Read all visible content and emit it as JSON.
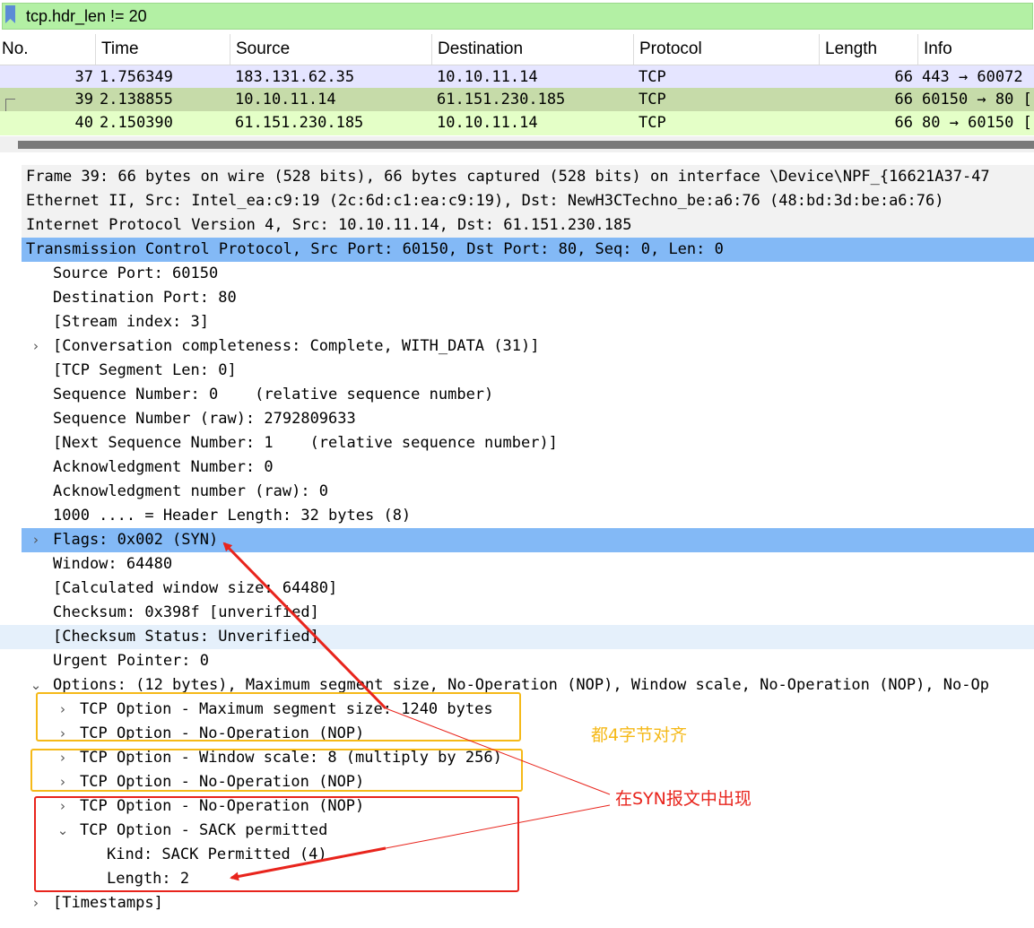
{
  "filter": {
    "value": "tcp.hdr_len != 20"
  },
  "columns": [
    "No.",
    "Time",
    "Source",
    "Destination",
    "Protocol",
    "Length",
    "Info"
  ],
  "packets": [
    {
      "no": "37",
      "time": "1.756349",
      "source": "183.131.62.35",
      "destination": "10.10.11.14",
      "protocol": "TCP",
      "length": "66",
      "info": "443 → 60072",
      "color": "#e5e5ff"
    },
    {
      "no": "39",
      "time": "2.138855",
      "source": "10.10.11.14",
      "destination": "61.151.230.185",
      "protocol": "TCP",
      "length": "66",
      "info": "60150 → 80 [",
      "color": "#c6dba9"
    },
    {
      "no": "40",
      "time": "2.150390",
      "source": "61.151.230.185",
      "destination": "10.10.11.14",
      "protocol": "TCP",
      "length": "66",
      "info": "80 → 60150 [",
      "color": "#e4ffc7"
    }
  ],
  "details": [
    {
      "indent": 0,
      "caret": ">",
      "text": "Frame 39: 66 bytes on wire (528 bits), 66 bytes captured (528 bits) on interface \\Device\\NPF_{16621A37-47",
      "style": "gray"
    },
    {
      "indent": 0,
      "caret": ">",
      "text": "Ethernet II, Src: Intel_ea:c9:19 (2c:6d:c1:ea:c9:19), Dst: NewH3CTechno_be:a6:76 (48:bd:3d:be:a6:76)",
      "style": "gray"
    },
    {
      "indent": 0,
      "caret": ">",
      "text": "Internet Protocol Version 4, Src: 10.10.11.14, Dst: 61.151.230.185",
      "style": "gray"
    },
    {
      "indent": 0,
      "caret": "v",
      "text": "Transmission Control Protocol, Src Port: 60150, Dst Port: 80, Seq: 0, Len: 0",
      "style": "sel"
    },
    {
      "indent": 1,
      "caret": "",
      "text": "Source Port: 60150",
      "style": ""
    },
    {
      "indent": 1,
      "caret": "",
      "text": "Destination Port: 80",
      "style": ""
    },
    {
      "indent": 1,
      "caret": "",
      "text": "[Stream index: 3]",
      "style": ""
    },
    {
      "indent": 1,
      "caret": ">",
      "text": "[Conversation completeness: Complete, WITH_DATA (31)]",
      "style": ""
    },
    {
      "indent": 1,
      "caret": "",
      "text": "[TCP Segment Len: 0]",
      "style": ""
    },
    {
      "indent": 1,
      "caret": "",
      "text": "Sequence Number: 0    (relative sequence number)",
      "style": ""
    },
    {
      "indent": 1,
      "caret": "",
      "text": "Sequence Number (raw): 2792809633",
      "style": ""
    },
    {
      "indent": 1,
      "caret": "",
      "text": "[Next Sequence Number: 1    (relative sequence number)]",
      "style": ""
    },
    {
      "indent": 1,
      "caret": "",
      "text": "Acknowledgment Number: 0",
      "style": ""
    },
    {
      "indent": 1,
      "caret": "",
      "text": "Acknowledgment number (raw): 0",
      "style": ""
    },
    {
      "indent": 1,
      "caret": "",
      "text": "1000 .... = Header Length: 32 bytes (8)",
      "style": ""
    },
    {
      "indent": 1,
      "caret": ">",
      "text": "Flags: 0x002 (SYN)",
      "style": "sel"
    },
    {
      "indent": 1,
      "caret": "",
      "text": "Window: 64480",
      "style": ""
    },
    {
      "indent": 1,
      "caret": "",
      "text": "[Calculated window size: 64480]",
      "style": ""
    },
    {
      "indent": 1,
      "caret": "",
      "text": "Checksum: 0x398f [unverified]",
      "style": ""
    },
    {
      "indent": 1,
      "caret": "",
      "text": "[Checksum Status: Unverified]",
      "style": "hov"
    },
    {
      "indent": 1,
      "caret": "",
      "text": "Urgent Pointer: 0",
      "style": ""
    },
    {
      "indent": 1,
      "caret": "v",
      "text": "Options: (12 bytes), Maximum segment size, No-Operation (NOP), Window scale, No-Operation (NOP), No-Op",
      "style": ""
    },
    {
      "indent": 2,
      "caret": ">",
      "text": "TCP Option - Maximum segment size: 1240 bytes",
      "style": ""
    },
    {
      "indent": 2,
      "caret": ">",
      "text": "TCP Option - No-Operation (NOP)",
      "style": ""
    },
    {
      "indent": 2,
      "caret": ">",
      "text": "TCP Option - Window scale: 8 (multiply by 256)",
      "style": ""
    },
    {
      "indent": 2,
      "caret": ">",
      "text": "TCP Option - No-Operation (NOP)",
      "style": ""
    },
    {
      "indent": 2,
      "caret": ">",
      "text": "TCP Option - No-Operation (NOP)",
      "style": ""
    },
    {
      "indent": 2,
      "caret": "v",
      "text": "TCP Option - SACK permitted",
      "style": ""
    },
    {
      "indent": 3,
      "caret": "",
      "text": "Kind: SACK Permitted (4)",
      "style": ""
    },
    {
      "indent": 3,
      "caret": "",
      "text": "Length: 2",
      "style": ""
    },
    {
      "indent": 1,
      "caret": ">",
      "text": "[Timestamps]",
      "style": ""
    }
  ],
  "annotations": {
    "aligned_note": "都4字节对齐",
    "syn_note": "在SYN报文中出现",
    "orange": "#f5b918",
    "red": "#e8241c"
  }
}
